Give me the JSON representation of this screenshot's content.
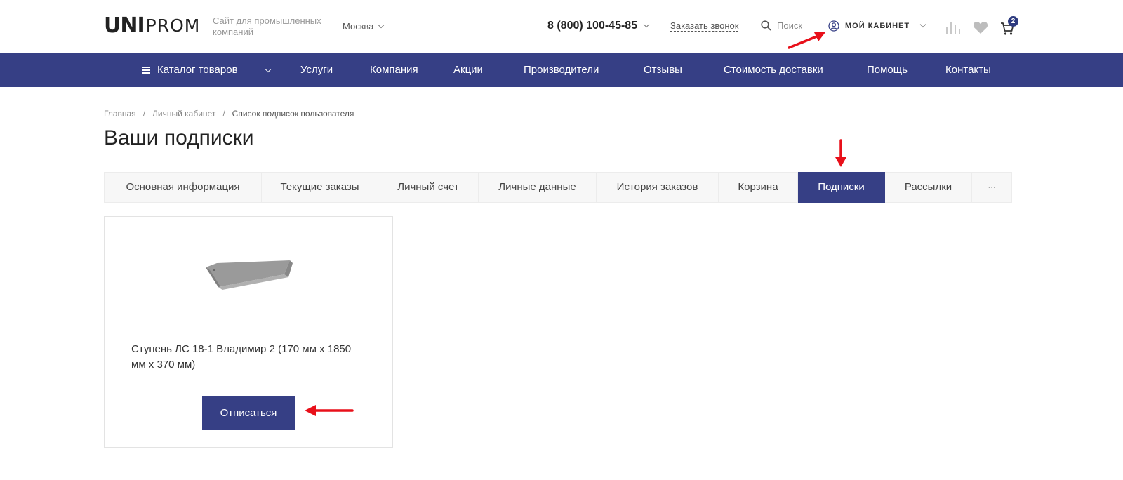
{
  "header": {
    "logo": {
      "uni": "UNI",
      "prom": "PROM"
    },
    "tagline": "Сайт для промышленных компаний",
    "city": "Москва",
    "phone": "8 (800) 100-45-85",
    "callback": "Заказать звонок",
    "search_label": "Поиск",
    "cabinet_label": "МОЙ КАБИНЕТ",
    "cart_count": "2"
  },
  "nav": {
    "catalog": "Каталог товаров",
    "items": [
      "Услуги",
      "Компания",
      "Акции",
      "Производители",
      "Отзывы",
      "Стоимость доставки",
      "Помощь",
      "Контакты"
    ]
  },
  "breadcrumb": [
    "Главная",
    "/",
    "Личный кабинет",
    "/",
    "Список подписок пользователя"
  ],
  "page_title": "Ваши подписки",
  "tabs": [
    "Основная информация",
    "Текущие заказы",
    "Личный счет",
    "Личные данные",
    "История заказов",
    "Корзина",
    "Подписки",
    "Рассылки",
    "···"
  ],
  "active_tab": "Подписки",
  "subscription": {
    "product_name": "Ступень ЛС 18-1 Владимир 2 (170 мм х 1850 мм х 370 мм)",
    "unsubscribe_label": "Отписаться"
  },
  "colors": {
    "brand": "#363f85",
    "annotation_arrow": "#e8101a"
  }
}
